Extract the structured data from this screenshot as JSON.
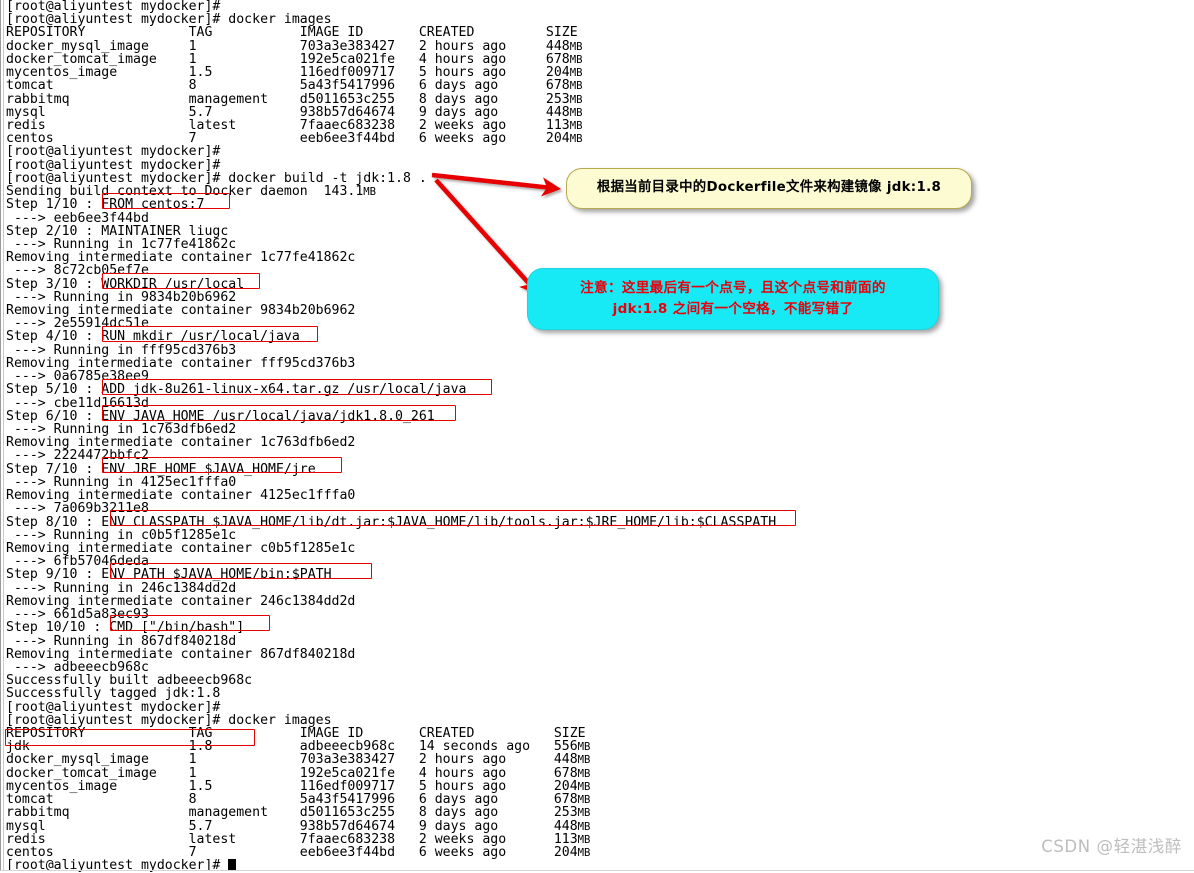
{
  "terminal": {
    "prompt": "[root@aliyuntest mydocker]#",
    "lines": [
      "[root@aliyuntest mydocker]#",
      "[root@aliyuntest mydocker]# docker images",
      "REPOSITORY             TAG           IMAGE ID       CREATED         SIZE",
      "docker_mysql_image     1             703a3e383427   2 hours ago     448MB",
      "docker_tomcat_image    1             192e5ca021fe   4 hours ago     678MB",
      "mycentos_image         1.5           116edf009717   5 hours ago     204MB",
      "tomcat                 8             5a43f5417996   6 days ago      678MB",
      "rabbitmq               management    d5011653c255   8 days ago      253MB",
      "mysql                  5.7           938b57d64674   9 days ago      448MB",
      "redis                  latest        7faaec683238   2 weeks ago     113MB",
      "centos                 7             eeb6ee3f44bd   6 weeks ago     204MB",
      "[root@aliyuntest mydocker]#",
      "[root@aliyuntest mydocker]#",
      "[root@aliyuntest mydocker]# docker build -t jdk:1.8 .",
      "Sending build context to Docker daemon  143.1MB",
      "Step 1/10 : FROM centos:7",
      " ---> eeb6ee3f44bd",
      "Step 2/10 : MAINTAINER liugc",
      " ---> Running in 1c77fe41862c",
      "Removing intermediate container 1c77fe41862c",
      " ---> 8c72cb05ef7e",
      "Step 3/10 : WORKDIR /usr/local",
      " ---> Running in 9834b20b6962",
      "Removing intermediate container 9834b20b6962",
      " ---> 2e55914dc51e",
      "Step 4/10 : RUN mkdir /usr/local/java",
      " ---> Running in fff95cd376b3",
      "Removing intermediate container fff95cd376b3",
      " ---> 0a6785e38ee9",
      "Step 5/10 : ADD jdk-8u261-linux-x64.tar.gz /usr/local/java",
      " ---> cbe11d16613d",
      "Step 6/10 : ENV JAVA_HOME /usr/local/java/jdk1.8.0_261",
      " ---> Running in 1c763dfb6ed2",
      "Removing intermediate container 1c763dfb6ed2",
      " ---> 2224472bbfc2",
      "Step 7/10 : ENV JRE_HOME $JAVA_HOME/jre",
      " ---> Running in 4125ec1fffa0",
      "Removing intermediate container 4125ec1fffa0",
      " ---> 7a069b3211e8",
      "Step 8/10 : ENV CLASSPATH $JAVA_HOME/lib/dt.jar:$JAVA_HOME/lib/tools.jar:$JRE_HOME/lib:$CLASSPATH",
      " ---> Running in c0b5f1285e1c",
      "Removing intermediate container c0b5f1285e1c",
      " ---> 6fb57046deda",
      "Step 9/10 : ENV PATH $JAVA_HOME/bin:$PATH",
      " ---> Running in 246c1384dd2d",
      "Removing intermediate container 246c1384dd2d",
      " ---> 661d5a83ec93",
      "Step 10/10 : CMD [\"/bin/bash\"]",
      " ---> Running in 867df840218d",
      "Removing intermediate container 867df840218d",
      " ---> adbeeecb968c",
      "Successfully built adbeeecb968c",
      "Successfully tagged jdk:1.8",
      "[root@aliyuntest mydocker]#",
      "[root@aliyuntest mydocker]# docker images",
      "REPOSITORY             TAG           IMAGE ID       CREATED          SIZE",
      "jdk                    1.8           adbeeecb968c   14 seconds ago   556MB",
      "docker_mysql_image     1             703a3e383427   2 hours ago      448MB",
      "docker_tomcat_image    1             192e5ca021fe   4 hours ago      678MB",
      "mycentos_image         1.5           116edf009717   5 hours ago      204MB",
      "tomcat                 8             5a43f5417996   6 days ago       678MB",
      "rabbitmq               management    d5011653c255   8 days ago       253MB",
      "mysql                  5.7           938b57d64674   9 days ago       448MB",
      "redis                  latest        7faaec683238   2 weeks ago      113MB",
      "centos                 7             eeb6ee3f44bd   6 weeks ago      204MB"
    ],
    "final_prompt": "[root@aliyuntest mydocker]# ",
    "commands": {
      "docker_images": "docker images",
      "docker_build": "docker build -t jdk:1.8 ."
    },
    "images_table_1": {
      "headers": [
        "REPOSITORY",
        "TAG",
        "IMAGE ID",
        "CREATED",
        "SIZE"
      ],
      "rows": [
        [
          "docker_mysql_image",
          "1",
          "703a3e383427",
          "2 hours ago",
          "448MB"
        ],
        [
          "docker_tomcat_image",
          "1",
          "192e5ca021fe",
          "4 hours ago",
          "678MB"
        ],
        [
          "mycentos_image",
          "1.5",
          "116edf009717",
          "5 hours ago",
          "204MB"
        ],
        [
          "tomcat",
          "8",
          "5a43f5417996",
          "6 days ago",
          "678MB"
        ],
        [
          "rabbitmq",
          "management",
          "d5011653c255",
          "8 days ago",
          "253MB"
        ],
        [
          "mysql",
          "5.7",
          "938b57d64674",
          "9 days ago",
          "448MB"
        ],
        [
          "redis",
          "latest",
          "7faaec683238",
          "2 weeks ago",
          "113MB"
        ],
        [
          "centos",
          "7",
          "eeb6ee3f44bd",
          "6 weeks ago",
          "204MB"
        ]
      ]
    },
    "images_table_2": {
      "headers": [
        "REPOSITORY",
        "TAG",
        "IMAGE ID",
        "CREATED",
        "SIZE"
      ],
      "rows": [
        [
          "jdk",
          "1.8",
          "adbeeecb968c",
          "14 seconds ago",
          "556MB"
        ],
        [
          "docker_mysql_image",
          "1",
          "703a3e383427",
          "2 hours ago",
          "448MB"
        ],
        [
          "docker_tomcat_image",
          "1",
          "192e5ca021fe",
          "4 hours ago",
          "678MB"
        ],
        [
          "mycentos_image",
          "1.5",
          "116edf009717",
          "5 hours ago",
          "204MB"
        ],
        [
          "tomcat",
          "8",
          "5a43f5417996",
          "6 days ago",
          "678MB"
        ],
        [
          "rabbitmq",
          "management",
          "d5011653c255",
          "8 days ago",
          "253MB"
        ],
        [
          "mysql",
          "5.7",
          "938b57d64674",
          "9 days ago",
          "448MB"
        ],
        [
          "redis",
          "latest",
          "7faaec683238",
          "2 weeks ago",
          "113MB"
        ],
        [
          "centos",
          "7",
          "eeb6ee3f44bd",
          "6 weeks ago",
          "204MB"
        ]
      ]
    },
    "build_summary": {
      "context": "Sending build context to Docker daemon  143.1MB",
      "built": "Successfully built adbeeecb968c",
      "tagged": "Successfully tagged jdk:1.8"
    },
    "highlighted_instructions": [
      "FROM centos:7",
      "WORKDIR /usr/local",
      "RUN mkdir /usr/local/java",
      "ADD jdk-8u261-linux-x64.tar.gz /usr/local/java",
      "ENV JAVA_HOME /usr/local/java/jdk1.8.0_261",
      "ENV JRE_HOME $JAVA_HOME/jre",
      "ENV CLASSPATH $JAVA_HOME/lib/dt.jar:$JAVA_HOME/lib/tools.jar:$JRE_HOME/lib:$CLASSPATH",
      "ENV PATH $JAVA_HOME/bin:$PATH",
      "CMD [\"/bin/bash\"]",
      "jdk                    1.8"
    ]
  },
  "annotations": {
    "yellow_note": "根据当前目录中的Dockerfile文件来构建镜像 jdk:1.8",
    "cyan_note_line1": "注意：这里最后有一个点号，且这个点号和前面的",
    "cyan_note_line2": "jdk:1.8 之间有一个空格，不能写错了"
  },
  "watermark": {
    "text": "CSDN @轻湛浅醉"
  },
  "colors": {
    "highlight_box": "#e60000",
    "arrow": "#e60000",
    "callout_yellow_bg": "#fdfbd2",
    "callout_yellow_border": "#b6a94e",
    "callout_cyan_bg": "#18eaf5",
    "callout_cyan_text": "#e8000d",
    "terminal_bg": "#ffffff",
    "terminal_fg": "#000000",
    "watermark": "#bdbdbd"
  }
}
